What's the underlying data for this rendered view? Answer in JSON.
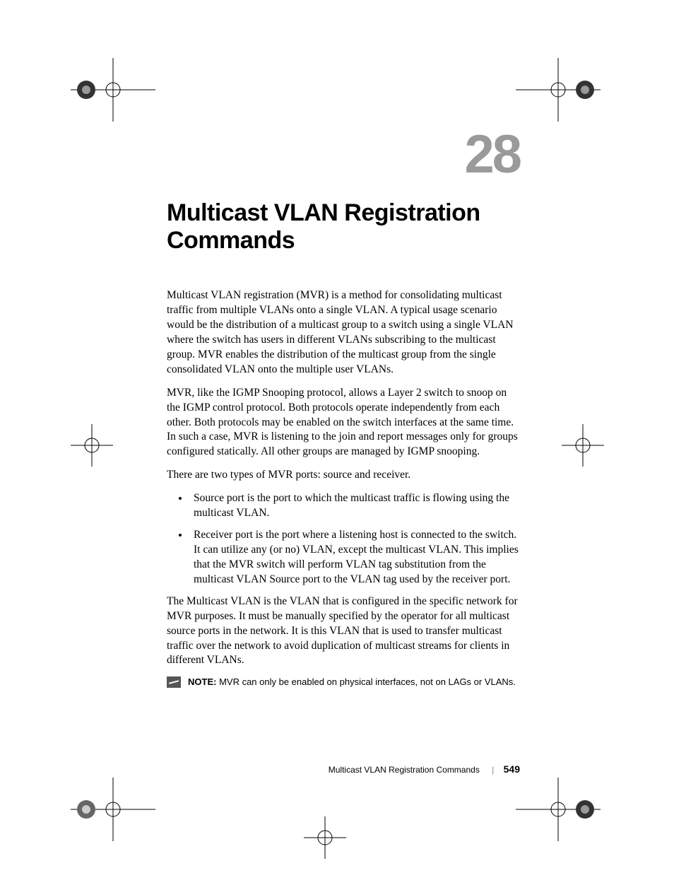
{
  "chapter": {
    "number": "28",
    "title": "Multicast VLAN Registration Commands"
  },
  "body": {
    "p1": "Multicast VLAN registration (MVR) is a method for consolidating multicast traffic from multiple VLANs onto a single VLAN. A typical usage scenario would be the distribution of a multicast group to a switch using a single VLAN where the switch has users in different VLANs subscribing to the multicast group. MVR enables the distribution of the multicast group from the single consolidated VLAN onto the multiple user VLANs.",
    "p2": "MVR, like the IGMP Snooping protocol, allows a Layer 2 switch to snoop on the IGMP control protocol.  Both protocols operate independently from each other.  Both protocols may be enabled on the switch interfaces at the same time.  In such a case, MVR is listening to the join and report messages only for groups configured statically.  All other groups are managed by IGMP snooping.",
    "p3": "There are two types of MVR ports: source and receiver.",
    "bullets": [
      "Source port is the port to which the multicast traffic is flowing using the multicast VLAN.",
      "Receiver port is the port where a listening host is connected to the switch. It can utilize any (or no) VLAN, except the multicast VLAN. This implies that the MVR  switch will perform VLAN tag substitution from the multicast VLAN Source port to the VLAN tag used by the receiver port."
    ],
    "p4": "The Multicast VLAN is the VLAN that is configured in the specific network for MVR purposes.  It must be manually specified by the operator for all multicast source ports in the network.  It is this VLAN that is used to transfer multicast traffic over the network to avoid duplication of multicast streams for clients in different VLANs.",
    "note_label": "NOTE:",
    "note_text": " MVR can only be enabled on physical interfaces, not on LAGs or VLANs."
  },
  "footer": {
    "section": "Multicast VLAN Registration Commands",
    "page": "549"
  }
}
